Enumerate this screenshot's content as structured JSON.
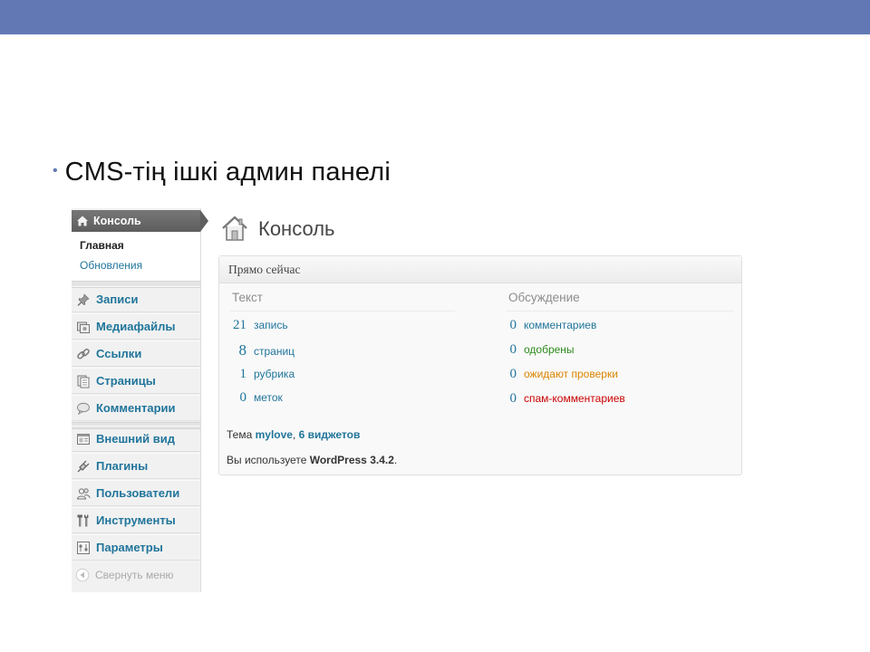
{
  "slide": {
    "bullet": "•",
    "title": "CMS-тің ішкі админ панелі"
  },
  "sidebar": {
    "header": "Консоль",
    "submenu": [
      {
        "label": "Главная",
        "active": true
      },
      {
        "label": "Обновления",
        "active": false
      }
    ],
    "group1": [
      {
        "label": "Записи",
        "icon": "pushpin-icon"
      },
      {
        "label": "Медиафайлы",
        "icon": "media-icon"
      },
      {
        "label": "Ссылки",
        "icon": "link-icon"
      },
      {
        "label": "Страницы",
        "icon": "pages-icon"
      },
      {
        "label": "Комментарии",
        "icon": "comment-icon"
      }
    ],
    "group2": [
      {
        "label": "Внешний вид",
        "icon": "appearance-icon"
      },
      {
        "label": "Плагины",
        "icon": "plugin-icon"
      },
      {
        "label": "Пользователи",
        "icon": "users-icon"
      },
      {
        "label": "Инструменты",
        "icon": "tools-icon"
      },
      {
        "label": "Параметры",
        "icon": "settings-icon"
      }
    ],
    "collapse": "Свернуть меню"
  },
  "main": {
    "title": "Консоль",
    "widget": {
      "header": "Прямо сейчас",
      "content_title": "Текст",
      "discussion_title": "Обсуждение",
      "content": [
        {
          "count": "21",
          "label": "запись"
        },
        {
          "count": "8",
          "label": "страниц"
        },
        {
          "count": "1",
          "label": "рубрика"
        },
        {
          "count": "0",
          "label": "меток"
        }
      ],
      "discussion": [
        {
          "count": "0",
          "label": "комментариев",
          "color": "#21759b"
        },
        {
          "count": "0",
          "label": "одобрены",
          "color": "#2e8b1f"
        },
        {
          "count": "0",
          "label": "ожидают проверки",
          "color": "#d98500"
        },
        {
          "count": "0",
          "label": "спам-комментариев",
          "color": "#cc0000"
        }
      ],
      "theme_prefix": "Тема",
      "theme_name": "mylove",
      "theme_sep": ",",
      "widgets_link": "6 виджетов",
      "version_prefix": "Вы используете",
      "version_name": "WordPress 3.4.2",
      "version_suffix": "."
    }
  },
  "colors": {
    "top_bar": "#6178b5",
    "link": "#21759b"
  }
}
